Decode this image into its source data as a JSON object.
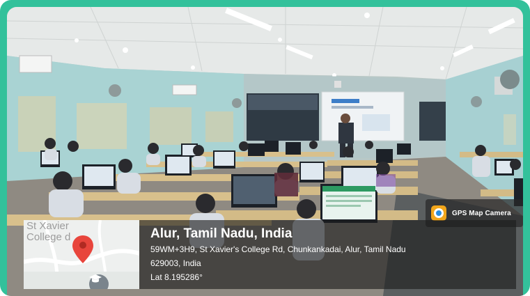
{
  "badge": {
    "label": "GPS Map Camera",
    "icon": "gps-map-camera-logo-icon"
  },
  "location": {
    "title": "Alur, Tamil Nadu, India",
    "address_line1": "59WM+3H9, St Xavier's College Rd, Chunkankadai, Alur, Tamil Nadu",
    "address_line2": "629003, India",
    "latitude": "Lat 8.195286°"
  },
  "map": {
    "label_line1": "St Xavier",
    "label_line2": "College d",
    "pin_icon": "map-pin-icon",
    "place_icon": "graduation-cap-icon",
    "colors": {
      "pin": "#e8453c",
      "frame": "#33c19b"
    }
  },
  "projection": {
    "slide_title": ""
  }
}
